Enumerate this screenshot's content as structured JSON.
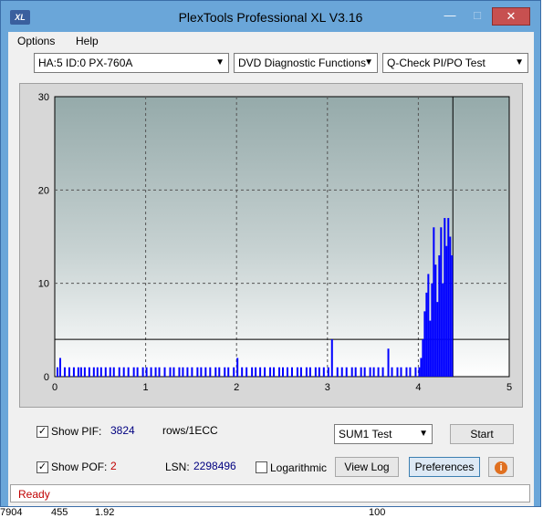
{
  "window": {
    "title": "PlexTools Professional XL V3.16",
    "icon_text": "XL",
    "min_glyph": "—",
    "max_glyph": "□",
    "close_glyph": "✕"
  },
  "menu": [
    "Options",
    "Help"
  ],
  "combos": {
    "drive": "HA:5 ID:0  PX-760A",
    "function": "DVD Diagnostic Functions",
    "test": "Q-Check PI/PO Test"
  },
  "chart_data": {
    "type": "bar",
    "xlabel": "",
    "ylabel": "",
    "xlim": [
      0,
      5
    ],
    "ylim": [
      0,
      30
    ],
    "x_ticks": [
      "0",
      "1",
      "2",
      "3",
      "4",
      "5"
    ],
    "y_ticks": [
      "0",
      "10",
      "20",
      "30"
    ],
    "threshold": 4,
    "end_marker_x": 4.38,
    "series": [
      {
        "color": "#0000ff",
        "points": [
          [
            0.02,
            1
          ],
          [
            0.05,
            2
          ],
          [
            0.1,
            1
          ],
          [
            0.15,
            1
          ],
          [
            0.2,
            1
          ],
          [
            0.25,
            1
          ],
          [
            0.28,
            1
          ],
          [
            0.32,
            1
          ],
          [
            0.37,
            1
          ],
          [
            0.42,
            1
          ],
          [
            0.46,
            1
          ],
          [
            0.5,
            1
          ],
          [
            0.55,
            1
          ],
          [
            0.6,
            1
          ],
          [
            0.64,
            1
          ],
          [
            0.7,
            1
          ],
          [
            0.75,
            1
          ],
          [
            0.8,
            1
          ],
          [
            0.86,
            1
          ],
          [
            0.9,
            1
          ],
          [
            0.96,
            1
          ],
          [
            1.0,
            1
          ],
          [
            1.05,
            1
          ],
          [
            1.1,
            1
          ],
          [
            1.14,
            1
          ],
          [
            1.2,
            1
          ],
          [
            1.26,
            1
          ],
          [
            1.3,
            1
          ],
          [
            1.36,
            1
          ],
          [
            1.4,
            1
          ],
          [
            1.45,
            1
          ],
          [
            1.5,
            1
          ],
          [
            1.56,
            1
          ],
          [
            1.6,
            1
          ],
          [
            1.65,
            1
          ],
          [
            1.7,
            1
          ],
          [
            1.76,
            1
          ],
          [
            1.8,
            1
          ],
          [
            1.86,
            1
          ],
          [
            1.9,
            1
          ],
          [
            1.96,
            1
          ],
          [
            2.0,
            2
          ],
          [
            2.05,
            1
          ],
          [
            2.1,
            1
          ],
          [
            2.16,
            1
          ],
          [
            2.2,
            1
          ],
          [
            2.25,
            1
          ],
          [
            2.3,
            1
          ],
          [
            2.36,
            1
          ],
          [
            2.4,
            1
          ],
          [
            2.46,
            1
          ],
          [
            2.5,
            1
          ],
          [
            2.55,
            1
          ],
          [
            2.6,
            1
          ],
          [
            2.66,
            1
          ],
          [
            2.7,
            1
          ],
          [
            2.76,
            1
          ],
          [
            2.8,
            1
          ],
          [
            2.86,
            1
          ],
          [
            2.9,
            1
          ],
          [
            2.95,
            1
          ],
          [
            3.0,
            1
          ],
          [
            3.04,
            4
          ],
          [
            3.1,
            1
          ],
          [
            3.15,
            1
          ],
          [
            3.2,
            1
          ],
          [
            3.26,
            1
          ],
          [
            3.3,
            1
          ],
          [
            3.36,
            1
          ],
          [
            3.4,
            1
          ],
          [
            3.46,
            1
          ],
          [
            3.5,
            1
          ],
          [
            3.55,
            1
          ],
          [
            3.6,
            1
          ],
          [
            3.66,
            3
          ],
          [
            3.7,
            1
          ],
          [
            3.76,
            1
          ],
          [
            3.8,
            1
          ],
          [
            3.86,
            1
          ],
          [
            3.9,
            1
          ],
          [
            3.96,
            1
          ],
          [
            4.0,
            1
          ],
          [
            4.02,
            2
          ],
          [
            4.04,
            4
          ],
          [
            4.06,
            7
          ],
          [
            4.08,
            9
          ],
          [
            4.1,
            11
          ],
          [
            4.12,
            6
          ],
          [
            4.14,
            10
          ],
          [
            4.16,
            16
          ],
          [
            4.18,
            12
          ],
          [
            4.2,
            8
          ],
          [
            4.22,
            13
          ],
          [
            4.24,
            16
          ],
          [
            4.26,
            10
          ],
          [
            4.28,
            17
          ],
          [
            4.3,
            14
          ],
          [
            4.32,
            17
          ],
          [
            4.34,
            15
          ],
          [
            4.36,
            13
          ]
        ]
      }
    ]
  },
  "controls": {
    "show_pif_label": "Show PIF:",
    "pif_value": "3824",
    "units": "rows/1ECC",
    "show_pof_label": "Show POF:",
    "pof_value": "2",
    "lsn_label": "LSN:",
    "lsn_value": "2298496",
    "logarithmic_label": "Logarithmic",
    "sum_select": "SUM1 Test",
    "start_label": "Start",
    "view_log_label": "View Log",
    "preferences_label": "Preferences",
    "info_glyph": "i",
    "check_glyph": "✓"
  },
  "status": "Ready",
  "bottom_row": [
    "7904",
    "455",
    "1.92",
    "100"
  ]
}
